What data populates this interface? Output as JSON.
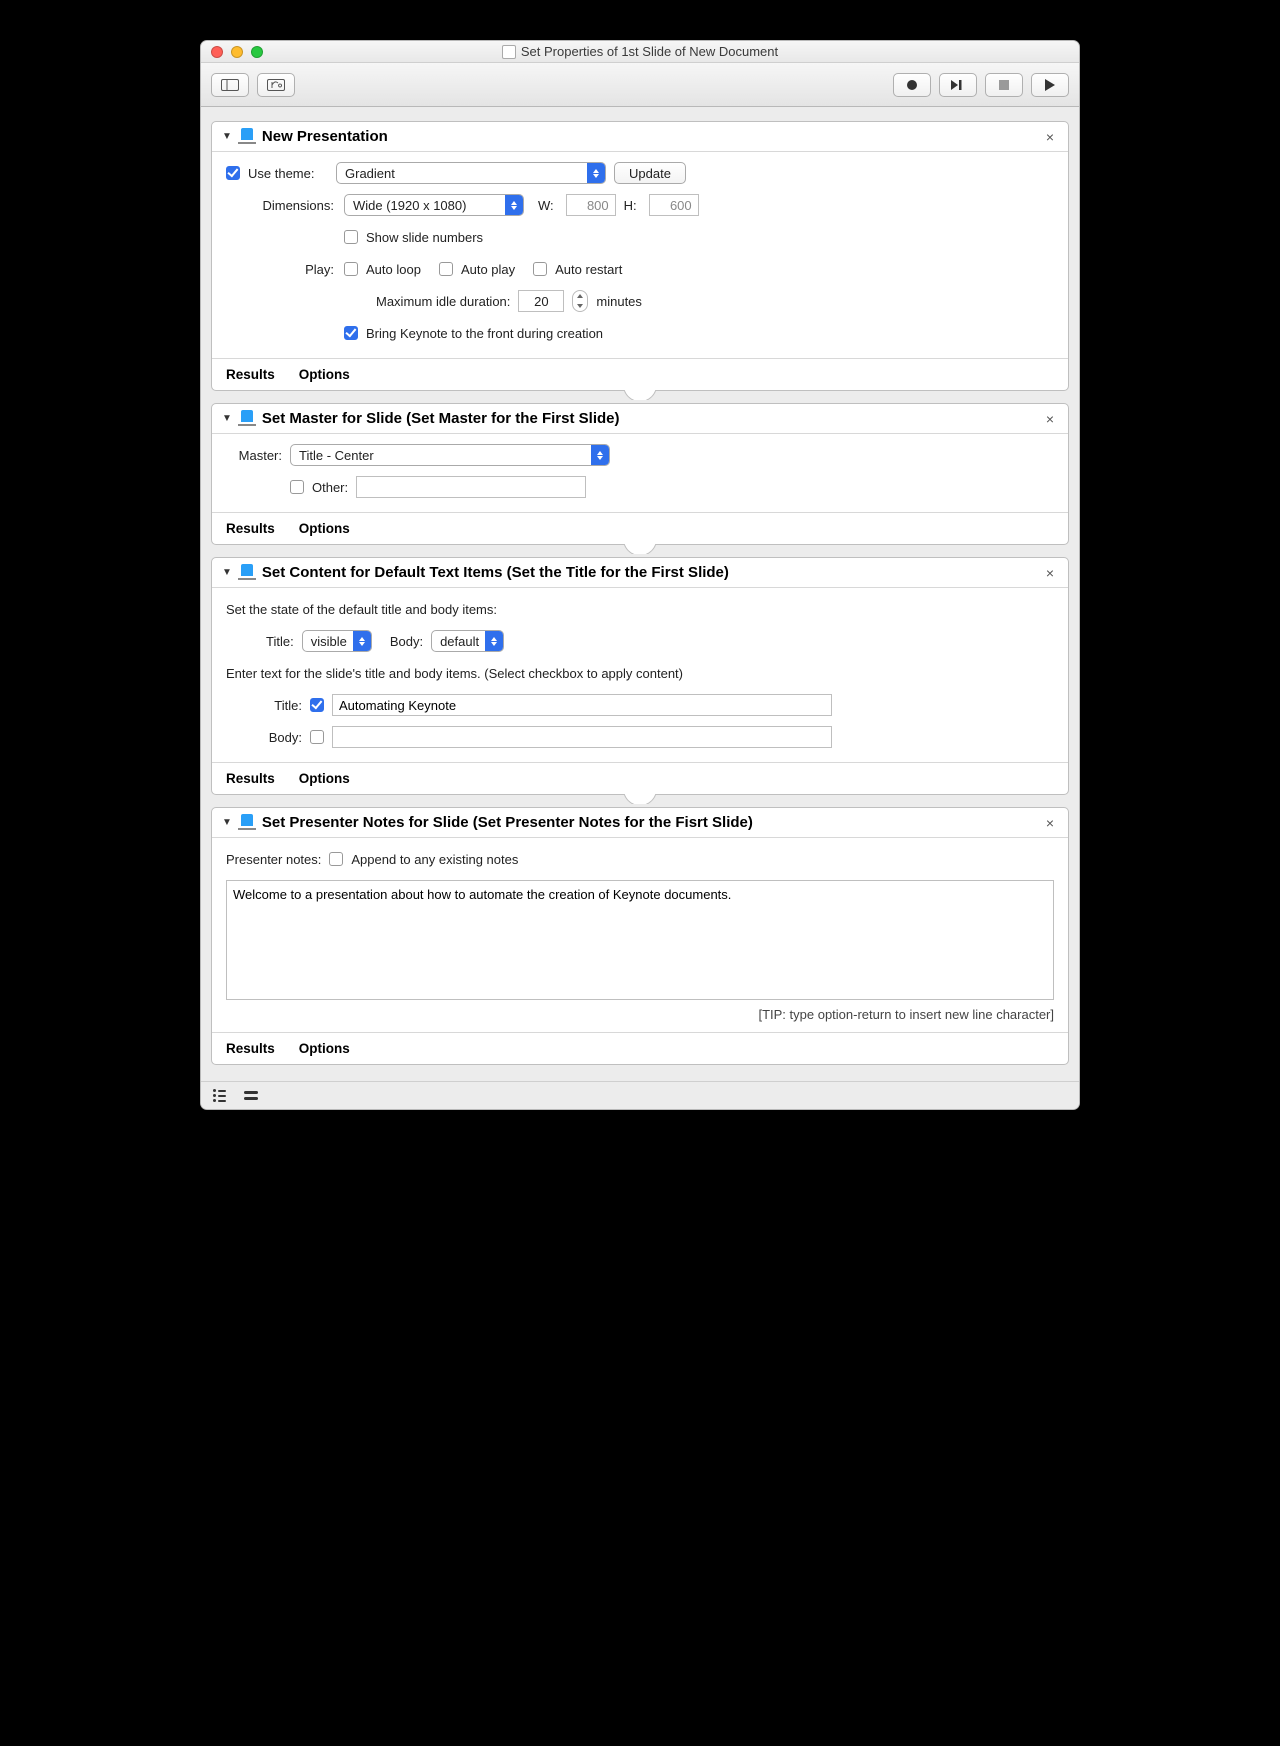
{
  "window": {
    "title": "Set Properties of 1st Slide of New Document"
  },
  "steps": {
    "newPresentation": {
      "title": "New Presentation",
      "useThemeLabel": "Use theme:",
      "useThemeChecked": true,
      "theme": "Gradient",
      "updateBtn": "Update",
      "dimensionsLabel": "Dimensions:",
      "dimensionsValue": "Wide (1920 x 1080)",
      "wLabel": "W:",
      "wValue": "800",
      "hLabel": "H:",
      "hValue": "600",
      "showSlideNumbers": "Show slide numbers",
      "playLabel": "Play:",
      "autoLoop": "Auto loop",
      "autoPlay": "Auto play",
      "autoRestart": "Auto restart",
      "maxIdleLabel": "Maximum idle duration:",
      "maxIdleValue": "20",
      "maxIdleUnit": "minutes",
      "bringFront": "Bring Keynote to the front during creation"
    },
    "setMaster": {
      "title": "Set Master for Slide (Set Master for the First Slide)",
      "masterLabel": "Master:",
      "masterValue": "Title - Center",
      "otherLabel": "Other:"
    },
    "setContent": {
      "title": "Set Content for Default Text Items (Set the Title for the First Slide)",
      "stateIntro": "Set the state of the default title and body items:",
      "titleLabel": "Title:",
      "titleState": "visible",
      "bodyLabel": "Body:",
      "bodyState": "default",
      "enterIntro": "Enter text for the slide's title and body items. (Select checkbox to apply content)",
      "titleText": "Automating Keynote",
      "bodyText": ""
    },
    "setNotes": {
      "title": "Set Presenter Notes for Slide (Set Presenter Notes for the Fisrt Slide)",
      "notesLabel": "Presenter notes:",
      "appendLabel": "Append to any existing notes",
      "notesText": "Welcome to a presentation about how to automate the creation of Keynote documents.",
      "tip": "[TIP: type option-return to insert new line character]"
    },
    "footer": {
      "results": "Results",
      "options": "Options"
    }
  }
}
